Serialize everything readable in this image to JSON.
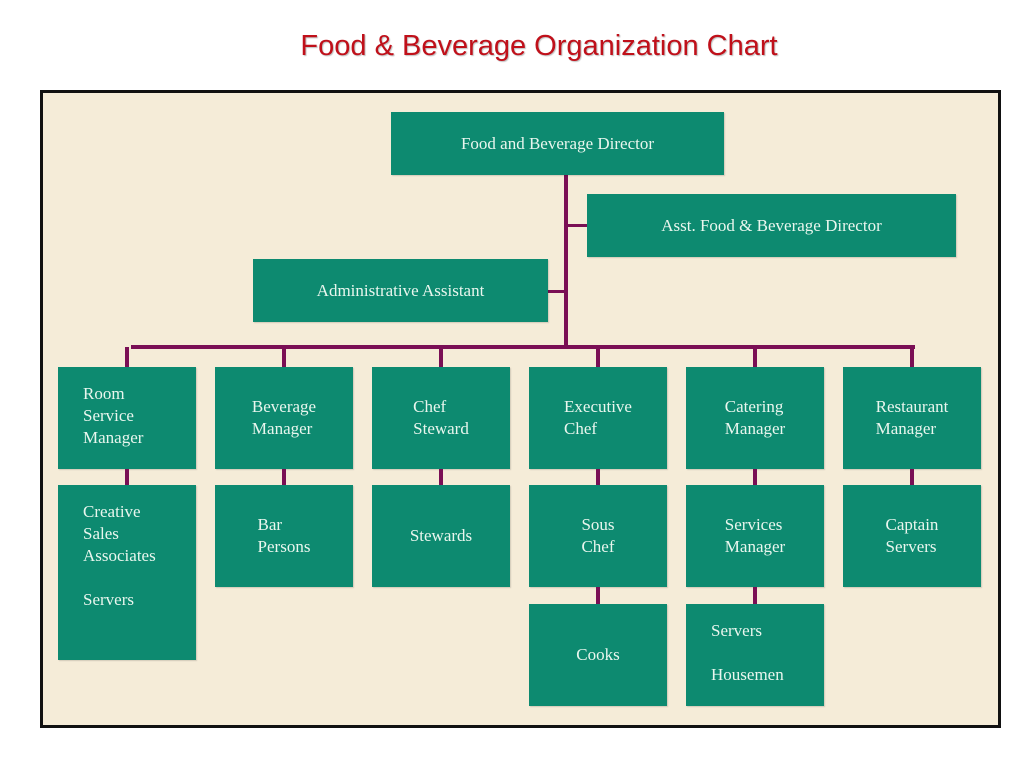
{
  "title": "Food & Beverage Organization Chart",
  "colors": {
    "title": "#c0101a",
    "box_fill": "#0d8a70",
    "box_text": "#e9f6ee",
    "connector": "#7a0f55",
    "background": "#f5ecd8"
  },
  "org": {
    "director": "Food and Beverage Director",
    "assistant_director": "Asst. Food & Beverage Director",
    "admin_assistant": "Administrative Assistant",
    "departments": [
      {
        "manager": [
          "Room",
          "Service",
          "Manager"
        ],
        "reports": [
          [
            "Creative",
            "Sales",
            "Associates",
            "",
            "Servers"
          ]
        ]
      },
      {
        "manager": [
          "Beverage",
          "Manager"
        ],
        "reports": [
          [
            "Bar",
            "Persons"
          ]
        ]
      },
      {
        "manager": [
          "Chef",
          "Steward"
        ],
        "reports": [
          [
            "Stewards"
          ]
        ]
      },
      {
        "manager": [
          "Executive",
          "Chef"
        ],
        "reports": [
          [
            "Sous",
            "Chef"
          ],
          [
            "Cooks"
          ]
        ]
      },
      {
        "manager": [
          "Catering",
          "Manager"
        ],
        "reports": [
          [
            "Services",
            "Manager"
          ],
          [
            "Servers",
            "",
            "Housemen"
          ]
        ]
      },
      {
        "manager": [
          "Restaurant",
          "Manager"
        ],
        "reports": [
          [
            "Captain",
            "Servers"
          ]
        ]
      }
    ]
  }
}
